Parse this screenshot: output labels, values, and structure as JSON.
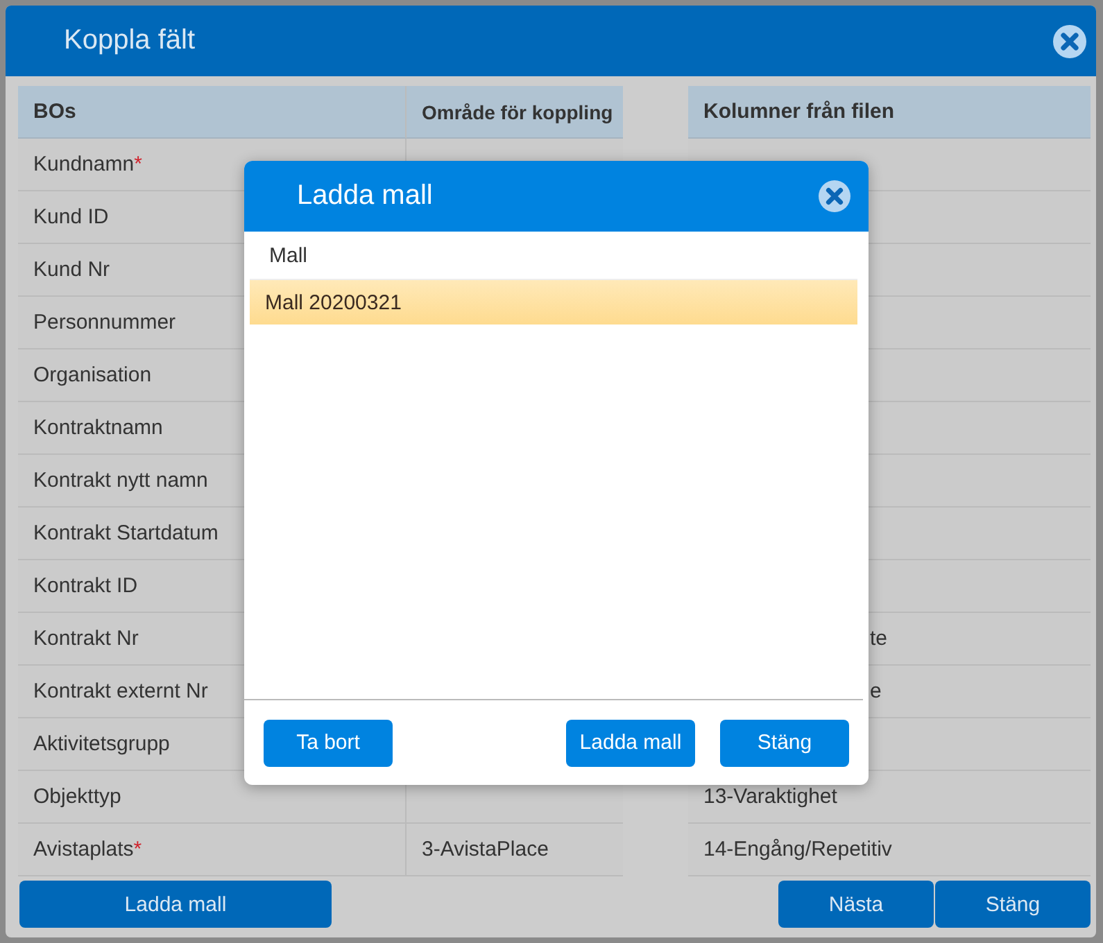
{
  "window": {
    "title": "Koppla fält"
  },
  "table": {
    "columns": [
      "BOs",
      "Område för koppling",
      "Kolumner från filen"
    ],
    "rows": [
      {
        "name": "Kundnamn",
        "required_mark": "*"
      },
      {
        "name": "Kund ID"
      },
      {
        "name": "Kund Nr"
      },
      {
        "name": "Personnummer"
      },
      {
        "name": "Organisation"
      },
      {
        "name": "Kontraktnamn"
      },
      {
        "name": "Kontrakt nytt namn"
      },
      {
        "name": "Kontrakt Startdatum"
      },
      {
        "name": "Kontrakt ID"
      },
      {
        "name": "Kontrakt Nr",
        "file_column": "te",
        "file_column_covered": true
      },
      {
        "name": "Kontrakt externt Nr",
        "file_column": "e",
        "file_column_covered": true
      },
      {
        "name": "Aktivitetsgrupp"
      },
      {
        "name": "Objekttyp",
        "file_column": "13-Varaktighet"
      },
      {
        "name": "Avistaplats",
        "required_mark": "*",
        "mapping": "3-AvistaPlace",
        "file_column": "14-Engång/Repetitiv"
      }
    ]
  },
  "buttons": {
    "left": [
      "Ladda mall"
    ],
    "right": [
      "Nästa",
      "Stäng"
    ]
  },
  "dialog": {
    "title": "Ladda mall",
    "list_header": "Mall",
    "items": [
      {
        "label": "Mall 20200321",
        "selected": true
      }
    ],
    "buttons": [
      {
        "label": "Ta bort",
        "kind": "left"
      },
      {
        "label": "Ladda mall",
        "kind": "right"
      },
      {
        "label": "Stäng",
        "kind": "right"
      }
    ]
  }
}
